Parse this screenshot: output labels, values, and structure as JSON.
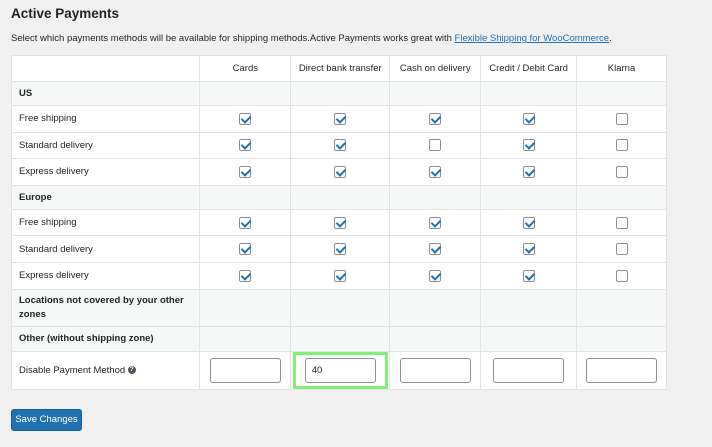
{
  "title": "Active Payments",
  "description": {
    "text": "Select which payments methods will be available for shipping methods.Active Payments works great with ",
    "link": "Flexible Shipping for WooCommerce",
    "suffix": "."
  },
  "columns": [
    "Cards",
    "Direct bank transfer",
    "Cash on delivery",
    "Credit / Debit Card",
    "Klarna"
  ],
  "zones": [
    {
      "name": "US",
      "rows": [
        {
          "label": "Free shipping",
          "checks": [
            true,
            true,
            true,
            true,
            false
          ]
        },
        {
          "label": "Standard delivery",
          "checks": [
            true,
            true,
            false,
            true,
            false
          ]
        },
        {
          "label": "Express delivery",
          "checks": [
            true,
            true,
            true,
            true,
            false
          ]
        }
      ]
    },
    {
      "name": "Europe",
      "rows": [
        {
          "label": "Free shipping",
          "checks": [
            true,
            true,
            true,
            true,
            false
          ]
        },
        {
          "label": "Standard delivery",
          "checks": [
            true,
            true,
            true,
            true,
            false
          ]
        },
        {
          "label": "Express delivery",
          "checks": [
            true,
            true,
            true,
            true,
            false
          ]
        }
      ]
    }
  ],
  "other_zones": [
    "Locations not covered by your other zones",
    "Other (without shipping zone)"
  ],
  "disable_row": {
    "label": "Disable Payment Method",
    "help_icon": "question-icon",
    "values": [
      "",
      "40",
      "",
      "",
      ""
    ],
    "highlighted_column": 1,
    "highlight_color": "#7ff07a"
  },
  "save_button": "Save Changes",
  "colors": {
    "accent": "#2271b1",
    "background": "#f0f0f1"
  }
}
